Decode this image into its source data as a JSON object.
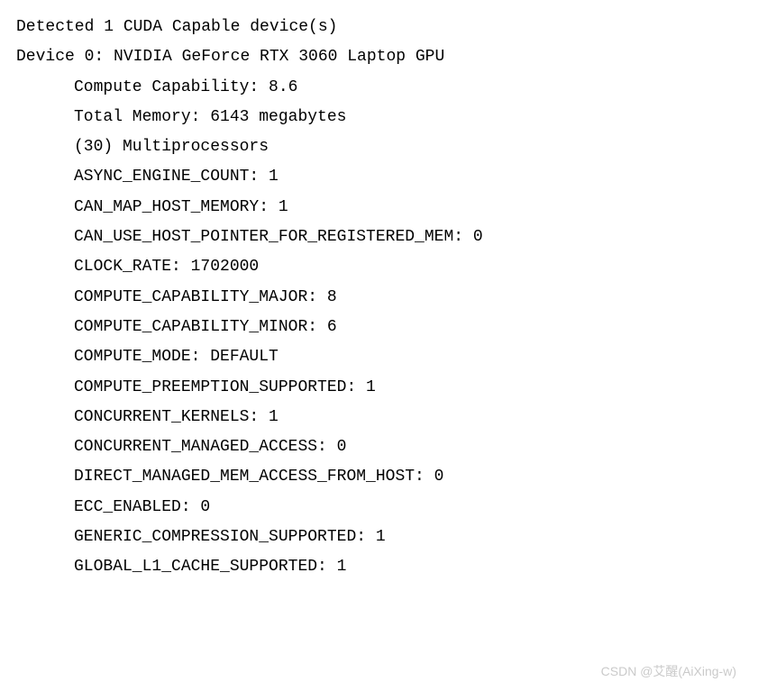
{
  "header": {
    "detected_line": "Detected 1 CUDA Capable device(s)",
    "device_line": "Device 0: NVIDIA GeForce RTX 3060 Laptop GPU"
  },
  "device_info": {
    "compute_capability": "Compute Capability: 8.6",
    "total_memory": "Total Memory: 6143 megabytes",
    "multiprocessors": "(30) Multiprocessors"
  },
  "attributes": [
    "ASYNC_ENGINE_COUNT: 1",
    "CAN_MAP_HOST_MEMORY: 1",
    "CAN_USE_HOST_POINTER_FOR_REGISTERED_MEM: 0",
    "CLOCK_RATE: 1702000",
    "COMPUTE_CAPABILITY_MAJOR: 8",
    "COMPUTE_CAPABILITY_MINOR: 6",
    "COMPUTE_MODE: DEFAULT",
    "COMPUTE_PREEMPTION_SUPPORTED: 1",
    "CONCURRENT_KERNELS: 1",
    "CONCURRENT_MANAGED_ACCESS: 0",
    "DIRECT_MANAGED_MEM_ACCESS_FROM_HOST: 0",
    "ECC_ENABLED: 0",
    "GENERIC_COMPRESSION_SUPPORTED: 1",
    "GLOBAL_L1_CACHE_SUPPORTED: 1"
  ],
  "watermark": "CSDN @艾醒(AiXing-w)"
}
